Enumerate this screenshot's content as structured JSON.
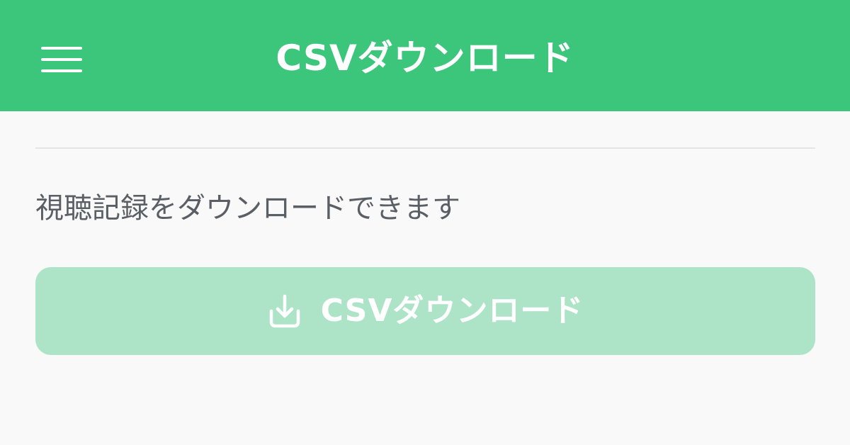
{
  "header": {
    "title": "CSVダウンロード",
    "menu_icon": "hamburger-menu-icon",
    "background_color": "#3cc67b"
  },
  "main": {
    "description": "視聴記録をダウンロードできます",
    "download_button": {
      "label": "CSVダウンロード",
      "icon": "download-icon",
      "background_color": "#ade4c8",
      "state": "disabled"
    }
  }
}
